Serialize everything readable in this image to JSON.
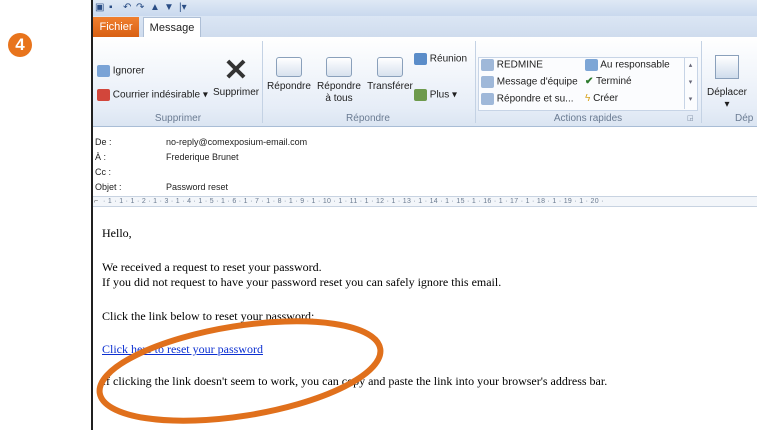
{
  "step_number": "4",
  "quick_access": {
    "icons": [
      "outlook-icon",
      "save-icon",
      "undo-icon",
      "redo-icon",
      "up-arrow-icon",
      "down-arrow-icon",
      "customize-icon"
    ]
  },
  "tabs": {
    "file": "Fichier",
    "message": "Message"
  },
  "ribbon": {
    "ignore": "Ignorer",
    "junk": "Courrier indésirable",
    "delete": "Supprimer",
    "reply": "Répondre",
    "reply_all_line1": "Répondre",
    "reply_all_line2": "à tous",
    "forward": "Transférer",
    "meeting": "Réunion",
    "more": "Plus",
    "quick_steps": [
      "REDMINE",
      "Message d'équipe",
      "Répondre et su...",
      "Au responsable",
      "Terminé",
      "Créer"
    ],
    "move": "Déplacer",
    "groups": {
      "delete": "Supprimer",
      "respond": "Répondre",
      "quick_steps": "Actions rapides",
      "move": "Dép"
    }
  },
  "header": {
    "from_label": "De :",
    "from": "no-reply@comexposium-email.com",
    "to_label": "À :",
    "to": "Frederique Brunet",
    "cc_label": "Cc :",
    "cc": "",
    "subject_label": "Objet :",
    "subject": "Password reset"
  },
  "ruler": "· 1 · 1 · 1 · 2 · 1 · 3 · 1 · 4 · 1 · 5 · 1 · 6 · 1 · 7 · 1 · 8 · 1 · 9 · 1 · 10 · 1 · 11 · 1 · 12 · 1 · 13 · 1 · 14 · 1 · 15 · 1 · 16 · 1 · 17 · 1 · 18 · 1 · 19 · 1 · 20 ·",
  "body": {
    "greeting": "Hello,",
    "line1": "We received a request to reset your password.",
    "line2": "If you did not request to have your password reset you can safely ignore this email.",
    "line3": "Click the link below to reset your password:",
    "link": "Click here to reset your password",
    "line4": "If clicking the link doesn't seem to work, you can copy and paste the link into your browser's address bar."
  },
  "colors": {
    "accent": "#e8741c",
    "link": "#0b2fd1",
    "file_tab": "#e46b1d"
  }
}
